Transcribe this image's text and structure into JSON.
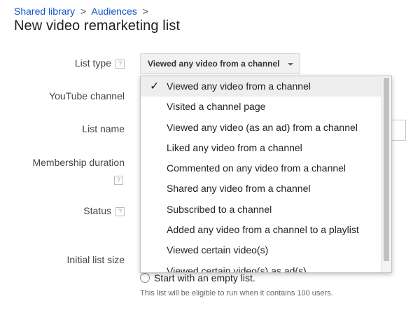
{
  "breadcrumb": {
    "items": [
      "Shared library",
      "Audiences"
    ],
    "separator": ">"
  },
  "page": {
    "title": "New video remarketing list"
  },
  "form": {
    "list_type_label": "List type",
    "youtube_channel_label": "YouTube channel",
    "list_name_label": "List name",
    "membership_duration_label": "Membership duration",
    "status_label": "Status",
    "initial_list_size_label": "Initial list size",
    "help_glyph": "?",
    "list_type_value": "Viewed any video from a channel",
    "empty_list_option": "Start with an empty list.",
    "eligibility_hint": "This list will be eligible to run when it contains 100 users."
  },
  "dropdown": {
    "check_glyph": "✓",
    "selected_index": 0,
    "options": [
      "Viewed any video from a channel",
      "Visited a channel page",
      "Viewed any video (as an ad) from a channel",
      "Liked any video from a channel",
      "Commented on any video from a channel",
      "Shared any video from a channel",
      "Subscribed to a channel",
      "Added any video from a channel to a playlist",
      "Viewed certain video(s)",
      "Viewed certain video(s) as ad(s)"
    ]
  },
  "colors": {
    "link": "#1155cc",
    "selected_row": "#eeeeee",
    "button_bg": "#f1f1f1"
  }
}
